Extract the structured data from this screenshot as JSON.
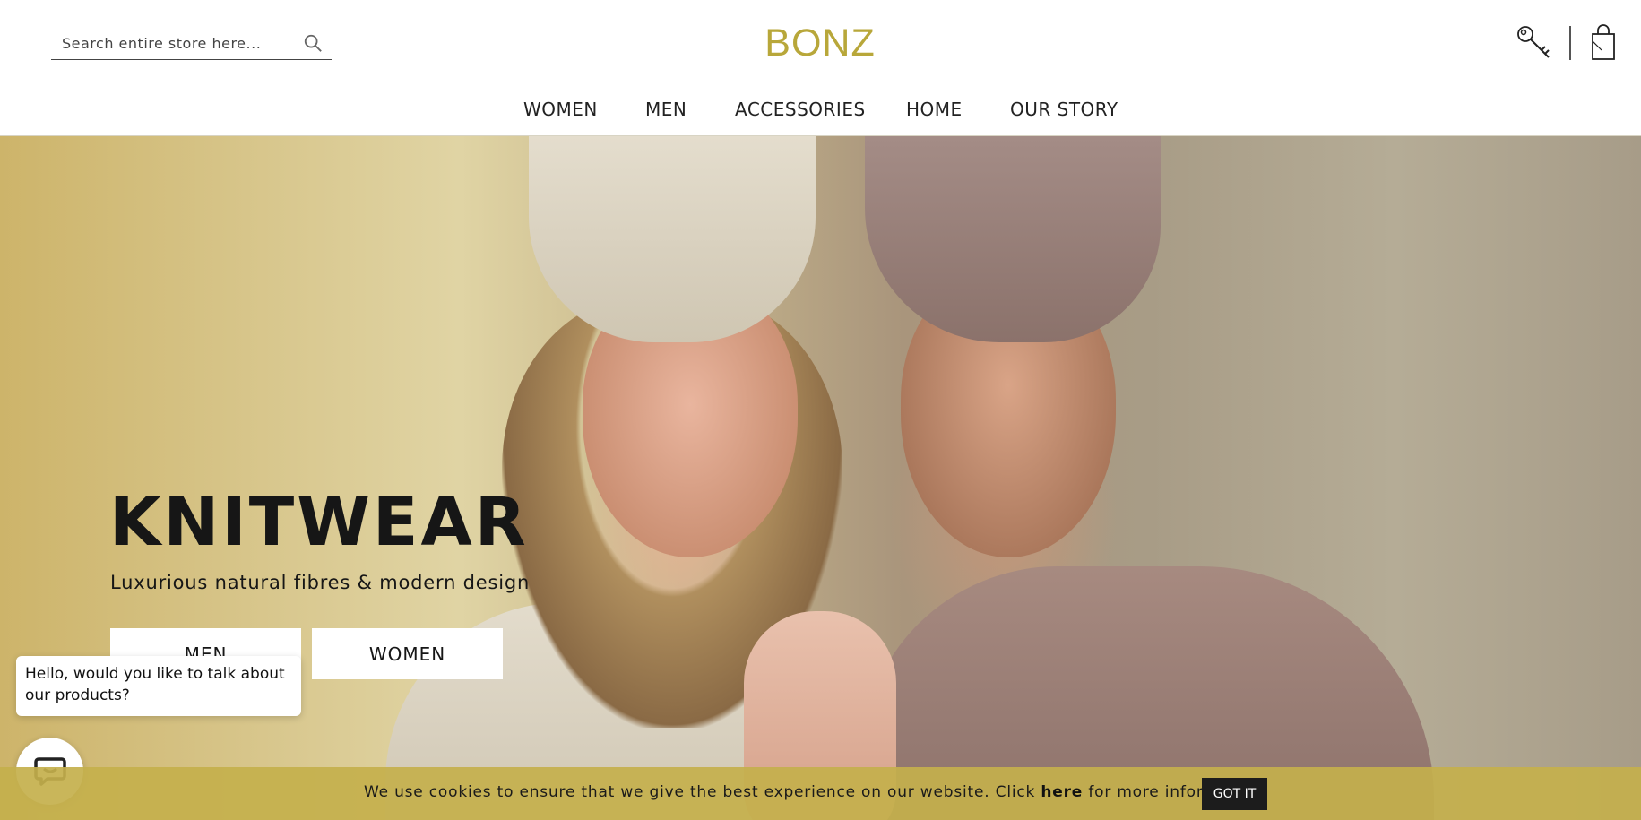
{
  "header": {
    "search": {
      "placeholder": "Search entire store here..."
    },
    "logo": "BONZ",
    "nav": [
      "WOMEN",
      "MEN",
      "ACCESSORIES",
      "HOME",
      "OUR STORY"
    ]
  },
  "hero": {
    "title": "KNITWEAR",
    "subtitle": "Luxurious natural fibres & modern design",
    "buttons": {
      "men": "MEN",
      "women": "WOMEN"
    }
  },
  "chat": {
    "message": "Hello, would you like to talk about our products?"
  },
  "cookie": {
    "text_before": "We use cookies to ensure that we give the best experience on our website. Click ",
    "link": "here",
    "text_after": " for more information",
    "button": "GOT IT"
  },
  "colors": {
    "brand": "#b8a73a",
    "cookie_bar": "#c4b04c",
    "button_dark": "#1c1c1c"
  },
  "icons": [
    "search-icon",
    "key-icon",
    "bag-icon",
    "chat-icon"
  ]
}
